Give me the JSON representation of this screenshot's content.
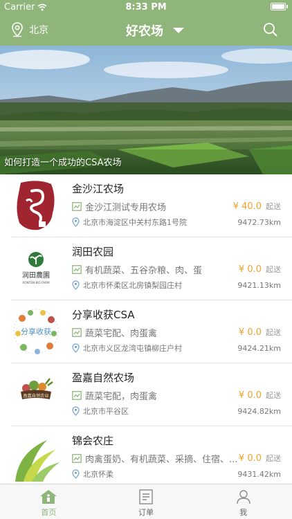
{
  "status_bar": {
    "carrier": "Carrier",
    "time": "8:33 PM"
  },
  "nav": {
    "city": "北京",
    "title": "好农场"
  },
  "banner": {
    "caption": "如何打造一个成功的CSA农场"
  },
  "colors": {
    "brand_green": "#8fb57a",
    "price_orange": "#f2a12c"
  },
  "farms": [
    {
      "name": "金沙江农场",
      "category": "金沙江测试专用农场",
      "address": "北京市海淀区中关村东路1号院",
      "price": "¥ 40.0",
      "price_unit": "起送",
      "distance": "9472.73km",
      "logo": "jinshajiang-logo"
    },
    {
      "name": "润田农园",
      "category": "有机蔬菜、五谷杂粮、肉、蛋",
      "address": "北京市怀柔区北房镇梨园庄村",
      "price": "¥ 0.0",
      "price_unit": "起送",
      "distance": "9421.13km",
      "logo": "runtian-logo",
      "logo_text": "润田農園",
      "logo_subtext": "RONTEN BIO FARM"
    },
    {
      "name": "分享收获CSA",
      "category": "蔬菜宅配、肉蛋禽",
      "address": "北京市义区龙湾屯镇柳庄户村",
      "price": "¥ 0.0",
      "price_unit": "起送",
      "distance": "9424.21km",
      "logo": "fenxiang-logo",
      "logo_text": "分享收获"
    },
    {
      "name": "盈嘉自然农场",
      "category": "蔬菜宅配，肉蛋禽",
      "address": "北京市平谷区",
      "price": "¥ 0.0",
      "price_unit": "起送",
      "distance": "9424.82km",
      "logo": "yingjia-logo",
      "logo_text": "盈嘉自然农业"
    },
    {
      "name": "锦会农庄",
      "category": "肉禽蛋奶、有机蔬菜、采摘、住宿、...",
      "address": "北京怀柔",
      "price": "¥ 0.0",
      "price_unit": "起送",
      "distance": "9431.42km",
      "logo": "jinhui-logo"
    }
  ],
  "tabs": [
    {
      "label": "首页",
      "icon": "home-icon",
      "active": true
    },
    {
      "label": "订单",
      "icon": "order-icon",
      "active": false
    },
    {
      "label": "我",
      "icon": "user-icon",
      "active": false
    }
  ]
}
